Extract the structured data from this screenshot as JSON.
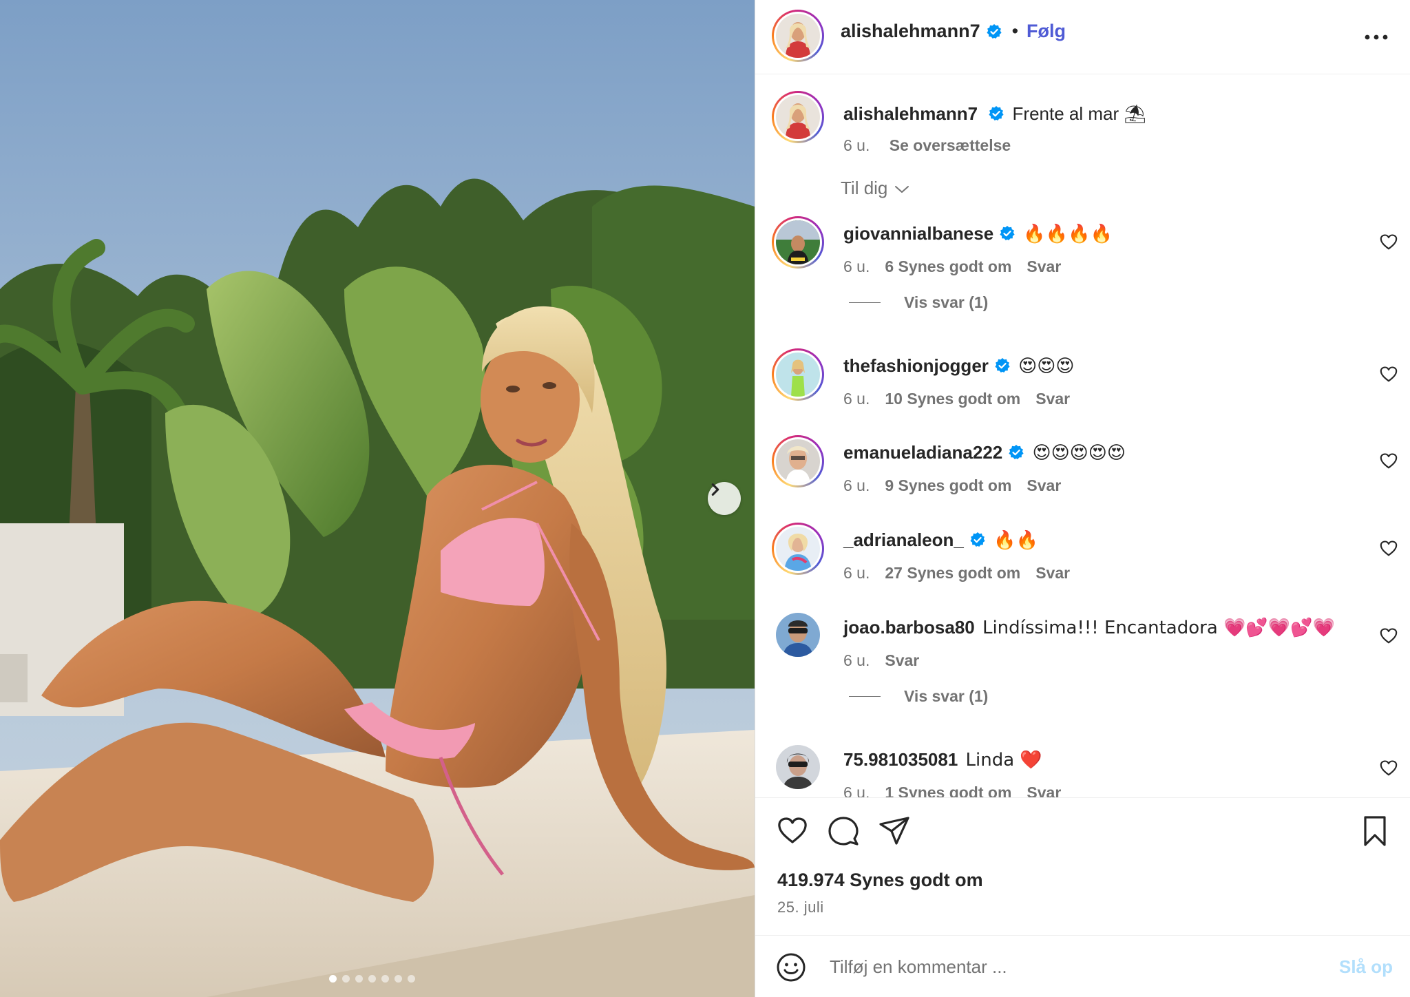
{
  "post": {
    "author": "alishalehmann7",
    "follow_label": "Følg",
    "caption": "Frente al mar",
    "caption_emoji": "⛱",
    "caption_time": "6 u.",
    "see_translation": "Se oversættelse",
    "image_count": 7,
    "active_image": 1
  },
  "sort": {
    "label": "Til dig"
  },
  "comments": [
    {
      "user": "giovannialbanese",
      "verified": true,
      "text": "🔥🔥🔥🔥",
      "time": "6 u.",
      "likes": "6 Synes godt om",
      "reply": "Svar",
      "view_replies": "Vis svar (1)"
    },
    {
      "user": "thefashionjogger",
      "verified": true,
      "text": "😍😍😍",
      "time": "6 u.",
      "likes": "10 Synes godt om",
      "reply": "Svar"
    },
    {
      "user": "emanueladiana222",
      "verified": true,
      "text": "😍😍😍😍😍",
      "time": "6 u.",
      "likes": "9 Synes godt om",
      "reply": "Svar"
    },
    {
      "user": "_adrianaleon_",
      "verified": true,
      "text": "🔥🔥",
      "time": "6 u.",
      "likes": "27 Synes godt om",
      "reply": "Svar"
    },
    {
      "user": "joao.barbosa80",
      "verified": false,
      "text": "Lindíssima!!! Encantadora 💗💕💗💕💗",
      "time": "6 u.",
      "reply": "Svar",
      "view_replies": "Vis svar (1)"
    },
    {
      "user": "75.981035081",
      "verified": false,
      "text": "Linda ❤️",
      "time": "6 u.",
      "likes": "1 Synes godt om",
      "reply": "Svar"
    }
  ],
  "stats": {
    "likes": "419.974 Synes godt om",
    "date": "25. juli"
  },
  "composer": {
    "placeholder": "Tilføj en kommentar ...",
    "post_label": "Slå op"
  },
  "colors": {
    "accent": "#4f5bd5",
    "verified": "#0095f6",
    "muted": "#737373",
    "post_disabled": "#b2dffc"
  },
  "icons": [
    "verified-icon",
    "more-icon",
    "chevron-right-icon",
    "chevron-down-icon",
    "heart-icon",
    "comment-icon",
    "share-icon",
    "bookmark-icon",
    "smiley-icon"
  ]
}
